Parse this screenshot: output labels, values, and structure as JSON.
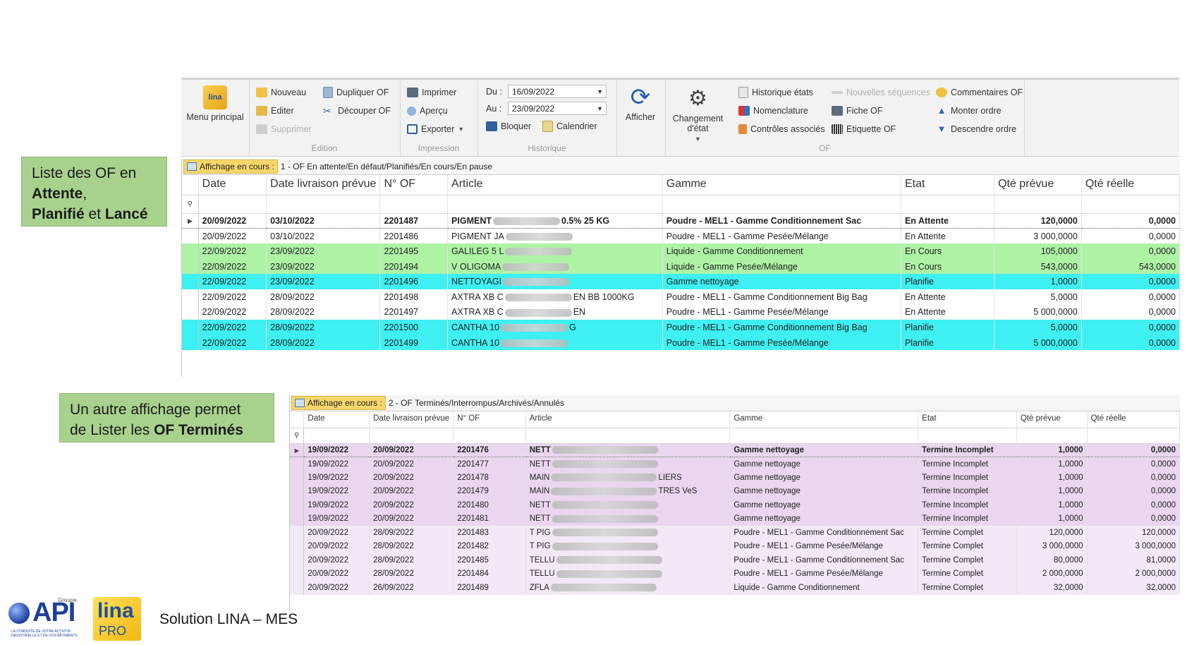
{
  "ribbon": {
    "menu_principal": "Menu principal",
    "edition": {
      "nouveau": "Nouveau",
      "editer": "Editer",
      "supprimer": "Supprimer",
      "dupliquer": "Dupliquer OF",
      "decouper": "Découper OF",
      "label": "Edition"
    },
    "impression": {
      "imprimer": "Imprimer",
      "apercu": "Aperçu",
      "exporter": "Exporter",
      "label": "Impression"
    },
    "historique": {
      "du_label": "Du :",
      "du_value": "16/09/2022",
      "au_label": "Au :",
      "au_value": "23/09/2022",
      "bloquer": "Bloquer",
      "calendrier": "Calendrier",
      "label": "Historique"
    },
    "afficher": "Afficher",
    "changement_etat": "Changement d'état",
    "of": {
      "historique_etats": "Historique états",
      "nomenclature": "Nomenclature",
      "controles": "Contrôles associés",
      "nouvelles_sequences": "Nouvelles séquences",
      "fiche_of": "Fiche OF",
      "etiquette_of": "Etiquette OF",
      "commentaires": "Commentaires OF",
      "monter": "Monter ordre",
      "descendre": "Descendre ordre",
      "label": "OF"
    }
  },
  "callouts": {
    "first": {
      "l1": "Liste des OF en",
      "attente": "Attente",
      "comma": ",",
      "planifie": "Planifié",
      "et": " et ",
      "lance": "Lancé"
    },
    "second": {
      "l1": "Un autre affichage permet",
      "l2": "de Lister les ",
      "of_termines": "OF Terminés"
    }
  },
  "grid1": {
    "view_label": "Affichage en cours :",
    "view_name": "1 - OF En attente/En défaut/Planifiés/En cours/En pause",
    "columns": [
      "Date",
      "Date livraison prévue",
      "N° OF",
      "Article",
      "Gamme",
      "Etat",
      "Qté prévue",
      "Qté réelle"
    ],
    "rows": [
      {
        "style": "white cur",
        "date": "20/09/2022",
        "livraison": "03/10/2022",
        "of": "2201487",
        "art_a": "PIGMENT",
        "art_b": "0.5% 25 KG",
        "gamme": "Poudre - MEL1 - Gamme Conditionnement Sac",
        "etat": "En Attente",
        "prevue": "120,0000",
        "reelle": "0,0000"
      },
      {
        "style": "white",
        "date": "20/09/2022",
        "livraison": "03/10/2022",
        "of": "2201486",
        "art_a": "PIGMENT JA",
        "art_b": "",
        "gamme": "Poudre - MEL1 - Gamme Pesée/Mélange",
        "etat": "En Attente",
        "prevue": "3 000,0000",
        "reelle": "0,0000"
      },
      {
        "style": "green",
        "date": "22/09/2022",
        "livraison": "23/09/2022",
        "of": "2201495",
        "art_a": "GALILEG 5 L",
        "art_b": "",
        "gamme": "Liquide - Gamme Conditionnement",
        "etat": "En Cours",
        "prevue": "105,0000",
        "reelle": "0,0000"
      },
      {
        "style": "green",
        "date": "22/09/2022",
        "livraison": "23/09/2022",
        "of": "2201494",
        "art_a": "V OLIGOMA",
        "art_b": "",
        "gamme": "Liquide - Gamme Pesée/Mélange",
        "etat": "En Cours",
        "prevue": "543,0000",
        "reelle": "543,0000"
      },
      {
        "style": "cyan",
        "date": "22/09/2022",
        "livraison": "23/09/2022",
        "of": "2201496",
        "art_a": "NETTOYAGI",
        "art_b": "",
        "gamme": "Gamme nettoyage",
        "etat": "Planifie",
        "prevue": "1,0000",
        "reelle": "0,0000"
      },
      {
        "style": "white",
        "date": "22/09/2022",
        "livraison": "28/09/2022",
        "of": "2201498",
        "art_a": "AXTRA XB C",
        "art_b": "EN BB 1000KG",
        "gamme": "Poudre - MEL1 - Gamme Conditionnement Big Bag",
        "etat": "En Attente",
        "prevue": "5,0000",
        "reelle": "0,0000"
      },
      {
        "style": "white",
        "date": "22/09/2022",
        "livraison": "28/09/2022",
        "of": "2201497",
        "art_a": "AXTRA XB C",
        "art_b": "EN",
        "gamme": "Poudre - MEL1 - Gamme Pesée/Mélange",
        "etat": "En Attente",
        "prevue": "5 000,0000",
        "reelle": "0,0000"
      },
      {
        "style": "cyan",
        "date": "22/09/2022",
        "livraison": "28/09/2022",
        "of": "2201500",
        "art_a": "CANTHA 10",
        "art_b": "G",
        "gamme": "Poudre - MEL1 - Gamme Conditionnement Big Bag",
        "etat": "Planifie",
        "prevue": "5,0000",
        "reelle": "0,0000"
      },
      {
        "style": "cyan",
        "date": "22/09/2022",
        "livraison": "28/09/2022",
        "of": "2201499",
        "art_a": "CANTHA 10",
        "art_b": "",
        "gamme": "Poudre - MEL1 - Gamme Pesée/Mélange",
        "etat": "Planifie",
        "prevue": "5 000,0000",
        "reelle": "0,0000"
      }
    ]
  },
  "grid2": {
    "view_label": "Affichage en cours :",
    "view_name": "2 - OF Terminés/Interrompus/Archivés/Annulés",
    "columns": [
      "Date",
      "Date livraison prévue",
      "N° OF",
      "Article",
      "Gamme",
      "Etat",
      "Qté prévue",
      "Qté réelle"
    ],
    "rows": [
      {
        "style": "pink cur",
        "date": "19/09/2022",
        "livraison": "20/09/2022",
        "of": "2201476",
        "art_a": "NETT",
        "art_b": "",
        "gamme": "Gamme nettoyage",
        "etat": "Termine Incomplet",
        "prevue": "1,0000",
        "reelle": "0,0000"
      },
      {
        "style": "pink",
        "date": "19/09/2022",
        "livraison": "20/09/2022",
        "of": "2201477",
        "art_a": "NETT",
        "art_b": "",
        "gamme": "Gamme nettoyage",
        "etat": "Termine Incomplet",
        "prevue": "1,0000",
        "reelle": "0,0000"
      },
      {
        "style": "pink",
        "date": "19/09/2022",
        "livraison": "20/09/2022",
        "of": "2201478",
        "art_a": "MAIN",
        "art_b": "LIERS",
        "gamme": "Gamme nettoyage",
        "etat": "Termine Incomplet",
        "prevue": "1,0000",
        "reelle": "0,0000"
      },
      {
        "style": "pink",
        "date": "19/09/2022",
        "livraison": "20/09/2022",
        "of": "2201479",
        "art_a": "MAIN",
        "art_b": "TRES VeS",
        "gamme": "Gamme nettoyage",
        "etat": "Termine Incomplet",
        "prevue": "1,0000",
        "reelle": "0,0000"
      },
      {
        "style": "pink",
        "date": "19/09/2022",
        "livraison": "20/09/2022",
        "of": "2201480",
        "art_a": "NETT",
        "art_b": "",
        "gamme": "Gamme nettoyage",
        "etat": "Termine Incomplet",
        "prevue": "1,0000",
        "reelle": "0,0000"
      },
      {
        "style": "pink",
        "date": "19/09/2022",
        "livraison": "20/09/2022",
        "of": "2201481",
        "art_a": "NETT",
        "art_b": "",
        "gamme": "Gamme nettoyage",
        "etat": "Termine Incomplet",
        "prevue": "1,0000",
        "reelle": "0,0000"
      },
      {
        "style": "pinkl",
        "date": "20/09/2022",
        "livraison": "28/09/2022",
        "of": "2201483",
        "art_a": "T PIG",
        "art_b": "",
        "gamme": "Poudre - MEL1 - Gamme Conditionnement Sac",
        "etat": "Termine Complet",
        "prevue": "120,0000",
        "reelle": "120,0000"
      },
      {
        "style": "pinkl",
        "date": "20/09/2022",
        "livraison": "28/09/2022",
        "of": "2201482",
        "art_a": "T PIG",
        "art_b": "",
        "gamme": "Poudre - MEL1 - Gamme Pesée/Mélange",
        "etat": "Termine Complet",
        "prevue": "3 000,0000",
        "reelle": "3 000,0000"
      },
      {
        "style": "pinkl",
        "date": "20/09/2022",
        "livraison": "28/09/2022",
        "of": "2201485",
        "art_a": "TELLU",
        "art_b": "",
        "gamme": "Poudre - MEL1 - Gamme Conditionnement Sac",
        "etat": "Termine Complet",
        "prevue": "80,0000",
        "reelle": "81,0000"
      },
      {
        "style": "pinkl",
        "date": "20/09/2022",
        "livraison": "28/09/2022",
        "of": "2201484",
        "art_a": "TELLU",
        "art_b": "",
        "gamme": "Poudre - MEL1 - Gamme Pesée/Mélange",
        "etat": "Termine Complet",
        "prevue": "2 000,0000",
        "reelle": "2 000,0000"
      },
      {
        "style": "pinkl",
        "date": "20/09/2022",
        "livraison": "26/09/2022",
        "of": "2201489",
        "art_a": "ZFLA",
        "art_b": "",
        "gamme": "Liquide - Gamme Conditionnement",
        "etat": "Termine Complet",
        "prevue": "32,0000",
        "reelle": "32,0000"
      }
    ]
  },
  "footer": {
    "api_group": "Groupe",
    "api_logo": "API",
    "api_tagline": "LA CONDUITE DE VOTRE ACTIVITÉ INDUSTRIELLE ET DE VOS BÂTIMENTS",
    "lina_logo": "lina",
    "lina_pro": "PRO",
    "solution": "Solution LINA – MES"
  },
  "colors": {
    "green_row": "#aef2a6",
    "cyan_row": "#3ff0f2",
    "pink_row": "#ead6ef",
    "callout": "#a9d18e"
  }
}
